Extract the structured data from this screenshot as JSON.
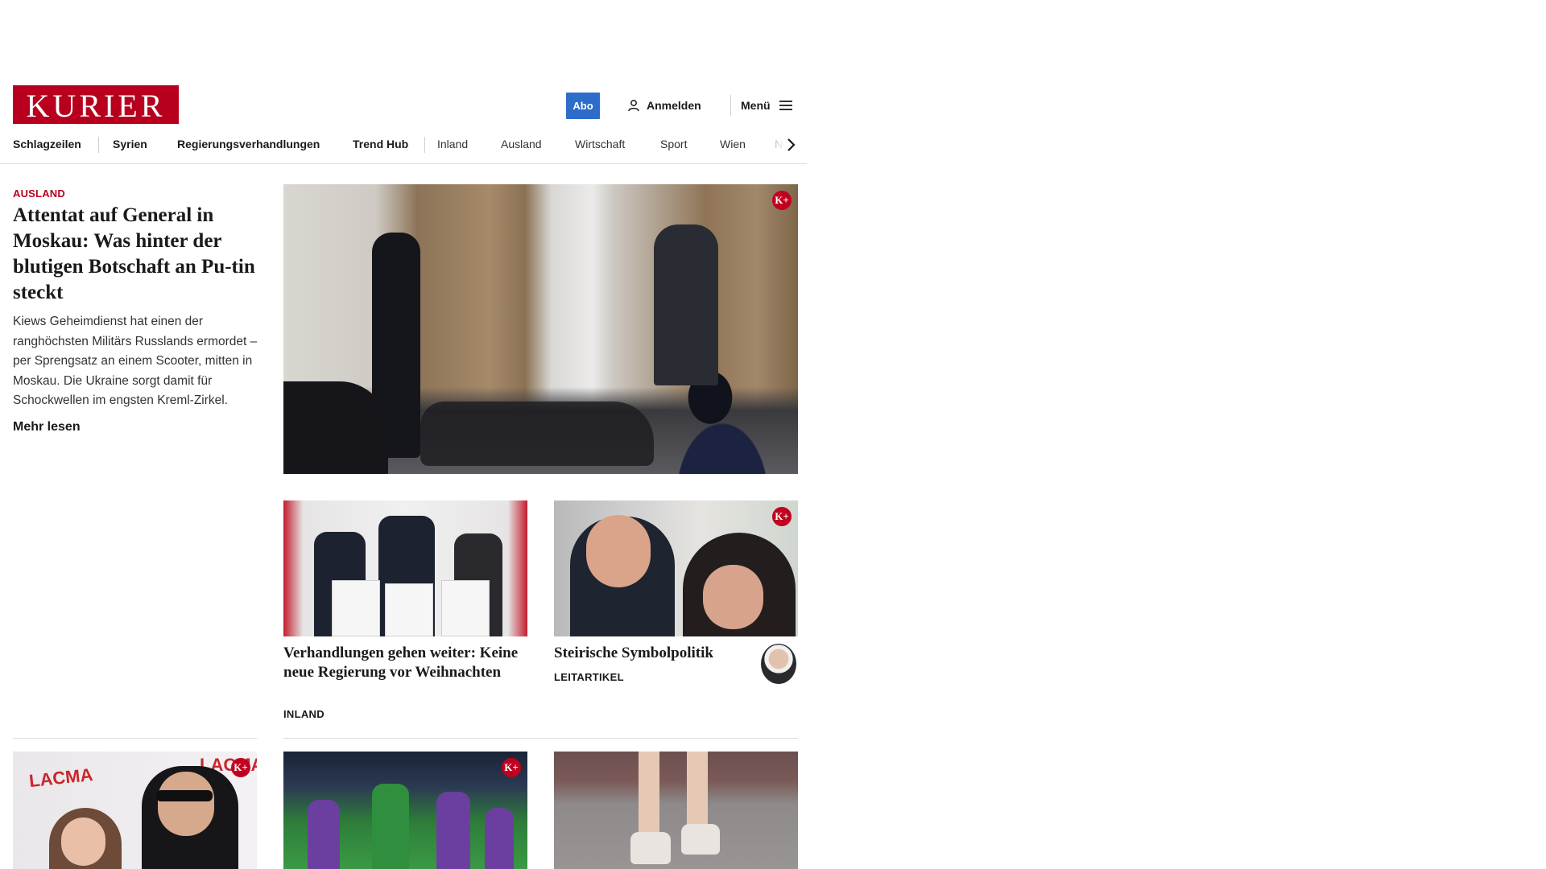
{
  "header": {
    "logo_text": "KURIER",
    "abo_label": "Abo",
    "login_label": "Anmelden",
    "menu_label": "Menü",
    "brand_color": "#b8001e",
    "abo_color": "#2d6dc9"
  },
  "nav": {
    "items": [
      "Schlagzeilen",
      "Syrien",
      "Regierungsverhandlungen",
      "Trend Hub",
      "Inland",
      "Ausland",
      "Wirtschaft",
      "Sport",
      "Wien",
      "NÖ"
    ]
  },
  "lead": {
    "kicker": "AUSLAND",
    "title": "Attentat auf General in Moskau: Was hinter der blutigen Botschaft an Pu-tin steckt",
    "teaser": "Kiews Geheimdienst hat einen der ranghöchsten Militärs Russlands ermordet – per Sprengsatz an einem Scooter, mitten in Moskau. Die Ukraine sorgt damit für Schockwellen im engsten Kreml-Zirkel.",
    "more_label": "Mehr lesen",
    "premium_badge": "K+"
  },
  "cards": [
    {
      "title": "Verhandlungen gehen weiter: Keine neue Regierung vor Weihnachten",
      "tag": "INLAND"
    },
    {
      "title": "Steirische Symbolpolitik",
      "tag": "LEITARTIKEL",
      "premium_badge": "K+"
    }
  ],
  "bottom_cards": [
    {
      "premium_badge": "K+",
      "image_text": [
        "LACMA",
        "LACMA"
      ]
    },
    {
      "premium_badge": "K+"
    },
    {}
  ]
}
